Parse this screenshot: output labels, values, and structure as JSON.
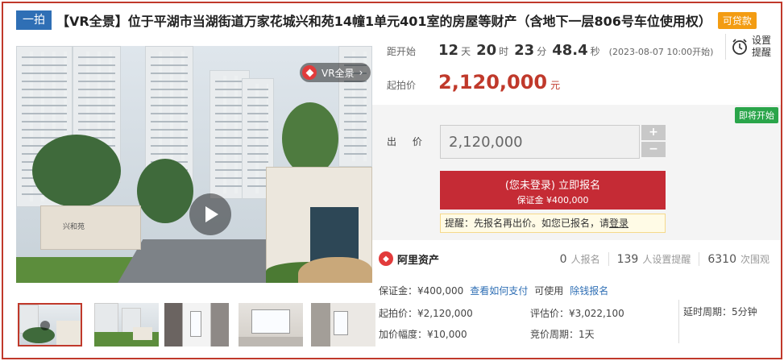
{
  "title": {
    "tag": "一拍",
    "text": "【VR全景】位于平湖市当湖街道万家花城兴和苑14幢1单元401室的房屋等财产（含地下一层806号车位使用权）",
    "loan_badge": "可贷款"
  },
  "media": {
    "vr_label": "VR全景",
    "gate_sign": "兴和苑",
    "play_icon": "play-icon",
    "thumbnails": [
      {
        "kind": "exterior-gate",
        "active": true
      },
      {
        "kind": "exterior-buildings",
        "active": false
      },
      {
        "kind": "interior-hallway",
        "active": false
      },
      {
        "kind": "interior-living-room",
        "active": false
      },
      {
        "kind": "interior-room",
        "active": false
      }
    ]
  },
  "countdown": {
    "label": "距开始",
    "days": "12",
    "days_unit": "天",
    "hours": "20",
    "hours_unit": "时",
    "minutes": "23",
    "minutes_unit": "分",
    "seconds": "48.4",
    "seconds_unit": "秒",
    "start_note": "(2023-08-07 10:00开始)"
  },
  "reminder": {
    "line1": "设置",
    "line2": "提醒",
    "icon": "alarm-clock-icon"
  },
  "price": {
    "label": "起拍价",
    "value": "2,120,000",
    "unit": "元"
  },
  "bid": {
    "status_badge": "即将开始",
    "label": "出 价",
    "input_value": "2,120,000",
    "plus": "+",
    "minus": "−",
    "signup_main": "(您未登录) 立即报名",
    "signup_deposit": "保证金 ¥400,000",
    "tip_prefix": "提醒：先报名再出价。如您已报名，请",
    "tip_link": "登录"
  },
  "platform": {
    "name": "阿里资产",
    "stats": [
      {
        "num": "0",
        "label": "人报名"
      },
      {
        "num": "139",
        "label": "人设置提醒"
      },
      {
        "num": "6310",
        "label": "次围观"
      }
    ]
  },
  "details": {
    "deposit": "保证金：¥400,000",
    "how_to_pay": "查看如何支付",
    "can_use": "可使用",
    "quick_signup": "除钱报名",
    "start_price": "起拍价：¥2,120,000",
    "increment": "加价幅度：¥10,000",
    "appraisal": "评估价：¥3,022,100",
    "bid_period": "竞价周期：1天",
    "delay": "延时周期：5分钟"
  },
  "colors": {
    "accent": "#c0392b",
    "link": "#2f6fb5",
    "success": "#2aa54a",
    "loan": "#f39c12"
  }
}
